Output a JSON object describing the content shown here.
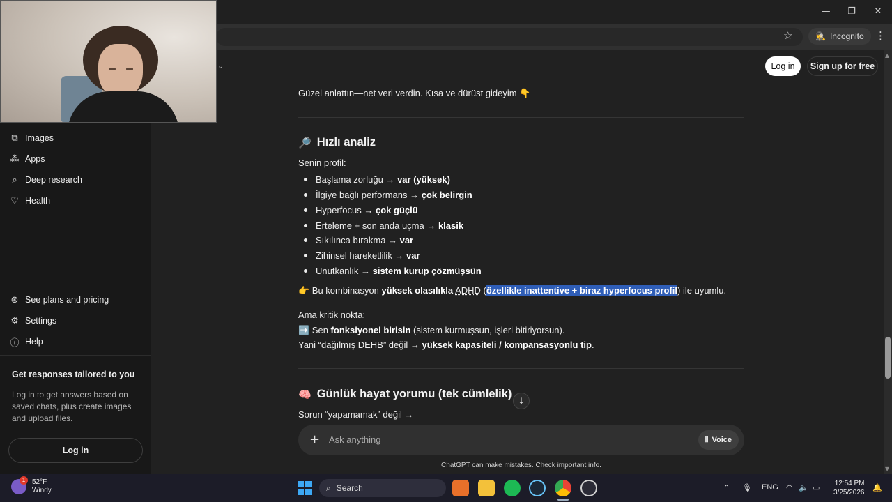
{
  "browser": {
    "incognito_label": "Incognito"
  },
  "header": {
    "login_label": "Log in",
    "signup_label": "Sign up for free"
  },
  "sidebar": {
    "items_top": [
      {
        "icon": "images-icon",
        "label": "Images"
      },
      {
        "icon": "apps-icon",
        "label": "Apps"
      },
      {
        "icon": "deep-research-icon",
        "label": "Deep research"
      },
      {
        "icon": "health-icon",
        "label": "Health"
      }
    ],
    "items_bottom": [
      {
        "icon": "plans-icon",
        "label": "See plans and pricing"
      },
      {
        "icon": "settings-icon",
        "label": "Settings"
      },
      {
        "icon": "help-icon",
        "label": "Help"
      }
    ],
    "promo_title": "Get responses tailored to you",
    "promo_text": "Log in to get answers based on saved chats, plus create images and upload files.",
    "login_label": "Log in"
  },
  "chat": {
    "intro": "Güzel anlattın—net veri verdin. Kısa ve dürüst gideyim 👇",
    "section1_title": "Hızlı analiz",
    "section1_emoji": "🔎",
    "profile_label": "Senin profil:",
    "bullets": [
      {
        "text": "Başlama zorluğu → ",
        "bold": "var (yüksek)"
      },
      {
        "text": "İlgiye bağlı performans → ",
        "bold": "çok belirgin"
      },
      {
        "text": "Hyperfocus → ",
        "bold": "çok güçlü"
      },
      {
        "text": "Erteleme + son anda uçma → ",
        "bold": "klasik"
      },
      {
        "text": "Sıkılınca bırakma → ",
        "bold": "var"
      },
      {
        "text": "Zihinsel hareketlilik → ",
        "bold": "var"
      },
      {
        "text": "Unutkanlık → ",
        "bold": "sistem kurup çözmüşsün"
      }
    ],
    "conclusion": {
      "emoji": "👉",
      "pre": " Bu kombinasyon ",
      "bold": "yüksek olasılıkla",
      "term": "ADHD",
      "paren_open": " (",
      "highlight": "özellikle inattentive + biraz hyperfocus profil",
      "paren_close": ")",
      "post": " ile uyumlu."
    },
    "critical_label": "Ama kritik nokta:",
    "critical_line1": {
      "emoji": "➡️",
      "pre": " Sen ",
      "bold": "fonksiyonel birisin",
      "post": " (sistem kurmuşsun, işleri bitiriyorsun)."
    },
    "critical_line2": {
      "pre": "Yani “dağılmış DEHB” değil → ",
      "bold": "yüksek kapasiteli / kompansasyonlu tip",
      "post": "."
    },
    "section2_title": "Günlük hayat yorumu (tek cümlelik)",
    "section2_emoji": "🧠",
    "section2_line": "Sorun “yapamamak” değil →"
  },
  "composer": {
    "placeholder": "Ask anything",
    "voice_label": "Voice"
  },
  "disclaimer": "ChatGPT can make mistakes. Check important info.",
  "taskbar": {
    "weather_temp": "52°F",
    "weather_desc": "Windy",
    "weather_badge": "1",
    "search_label": "Search",
    "language": "ENG",
    "time": "12:54 PM",
    "date": "3/25/2026"
  },
  "colors": {
    "highlight": "#2f5eb8",
    "background": "#212121",
    "sidebar": "#181818"
  }
}
